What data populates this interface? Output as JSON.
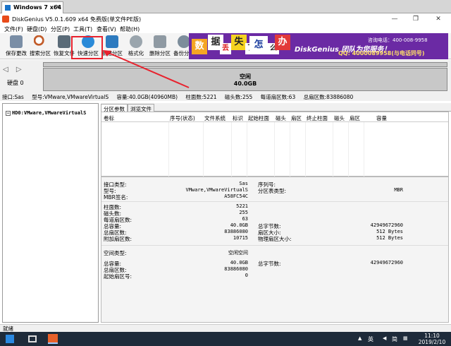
{
  "vm": {
    "tab_title": "Windows 7 x64",
    "close": "×"
  },
  "window": {
    "title": "DiskGenius V5.0.1.609 x64 免费版(单文件PE版)",
    "minimize": "—",
    "maximize": "❐",
    "close": "✕"
  },
  "menu": [
    "文件(F)",
    "硬盘(D)",
    "分区(P)",
    "工具(T)",
    "查看(V)",
    "帮助(H)"
  ],
  "toolbar": [
    {
      "label": "保存更改",
      "icon": "save-icon",
      "color": "#7a8ea6"
    },
    {
      "label": "搜索分区",
      "icon": "search-icon",
      "color": "#c25c2a"
    },
    {
      "label": "恢复文件",
      "icon": "restore-icon",
      "color": "#5a6b78"
    },
    {
      "label": "快速分区",
      "icon": "quick-partition-icon",
      "color": "#2a8ad8"
    },
    {
      "label": "新建分区",
      "icon": "new-partition-icon",
      "color": "#2e7bbf"
    },
    {
      "label": "格式化",
      "icon": "format-icon",
      "color": "#9aa5ad"
    },
    {
      "label": "删除分区",
      "icon": "delete-icon",
      "color": "#8f9aa3"
    },
    {
      "label": "备份分区",
      "icon": "backup-icon",
      "color": "#7c8d9b"
    }
  ],
  "banner": {
    "chars": [
      "数",
      "据",
      "丢",
      "失",
      "了",
      "怎",
      "么",
      "办"
    ],
    "pitch": "DiskGenius 团队为您服务！",
    "tel": "咨询电话：400-008-9958",
    "qq": "QQ: 4000089958(与电话同号)"
  },
  "diskmap": {
    "nav": "◁ ▷",
    "disk_label": "硬盘 0",
    "partition_name": "空闲",
    "partition_size": "40.0GB"
  },
  "infoline": [
    "接口:Sas",
    "型号:VMware,VMwareVirtualS",
    "容量:40.0GB(40960MB)",
    "柱面数:5221",
    "磁头数:255",
    "每道扇区数:63",
    "总扇区数:83886080"
  ],
  "tree": {
    "expander": "−",
    "item": "HD0:VMware,VMwareVirtualS"
  },
  "tabs": [
    "分区参数",
    "浏览文件"
  ],
  "grid_headers": [
    "卷标",
    "序号(状态)",
    "文件系统",
    "标识",
    "起始柱面",
    "磁头",
    "扇区",
    "终止柱面",
    "磁头",
    "扇区",
    "容量"
  ],
  "details": {
    "interface_label": "接口类型:",
    "interface_value": "Sas",
    "serial_label": "序列号:",
    "model_label": "型号:",
    "model_value": "VMware,VMwareVirtualS",
    "table_type_label": "分区表类型:",
    "table_type_value": "MBR",
    "mbr_sig_label": "MBR签名:",
    "mbr_sig_value": "A58FC54C",
    "cylinders_label": "柱面数:",
    "cylinders_value": "5221",
    "heads_label": "磁头数:",
    "heads_value": "255",
    "spt_label": "每道扇区数:",
    "spt_value": "63",
    "capacity_label": "总容量:",
    "capacity_value": "40.0GB",
    "total_bytes_label": "总字节数:",
    "total_bytes_value": "42949672960",
    "total_sectors_label": "总扇区数:",
    "total_sectors_value": "83886080",
    "sector_size_label": "扇区大小:",
    "sector_size_value": "512 Bytes",
    "extra_sectors_label": "附加扇区数:",
    "extra_sectors_value": "10715",
    "phys_sector_label": "物理扇区大小:",
    "phys_sector_value": "512 Bytes",
    "space_type_label": "空间类型:",
    "space_type_value": "空闲空间",
    "free_capacity_label": "总容量:",
    "free_capacity_value": "40.0GB",
    "free_bytes_label": "总字节数:",
    "free_bytes_value": "42949672960",
    "free_sectors_label": "总扇区数:",
    "free_sectors_value": "83886080",
    "start_sector_label": "起始扇区号:",
    "start_sector_value": "0"
  },
  "status": "就绪",
  "taskbar": {
    "lang": "英",
    "ime": "简",
    "time": "11:10",
    "date": "2019/2/10"
  }
}
